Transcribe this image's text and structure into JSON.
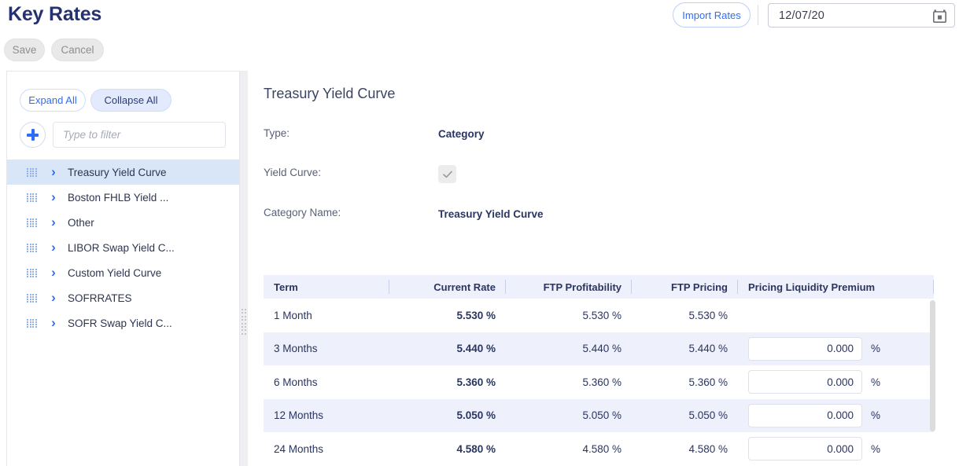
{
  "header": {
    "title": "Key Rates",
    "save_label": "Save",
    "cancel_label": "Cancel",
    "import_label": "Import Rates",
    "date_value": "12/07/20",
    "calendar_icon": "calendar-icon"
  },
  "sidebar": {
    "expand_all_label": "Expand All",
    "collapse_all_label": "Collapse All",
    "add_icon": "plus-icon",
    "filter_placeholder": "Type to filter",
    "filter_value": "",
    "items": [
      {
        "label": "Treasury Yield Curve",
        "selected": true
      },
      {
        "label": "Boston FHLB Yield ...",
        "selected": false
      },
      {
        "label": "Other",
        "selected": false
      },
      {
        "label": "LIBOR Swap Yield C...",
        "selected": false
      },
      {
        "label": "Custom Yield Curve",
        "selected": false
      },
      {
        "label": "SOFRRATES",
        "selected": false
      },
      {
        "label": "SOFR Swap Yield C...",
        "selected": false
      }
    ]
  },
  "detail": {
    "title": "Treasury Yield Curve",
    "type_label": "Type:",
    "type_value": "Category",
    "yield_curve_label": "Yield Curve:",
    "yield_curve_checked": true,
    "category_name_label": "Category Name:",
    "category_name_value": "Treasury Yield Curve"
  },
  "table": {
    "columns": [
      "Term",
      "Current Rate",
      "FTP Profitability",
      "FTP Pricing",
      "Pricing Liquidity Premium"
    ],
    "percent_suffix": "%",
    "rows": [
      {
        "term": "1 Month",
        "current_rate": "5.530 %",
        "ftp_profitability": "5.530 %",
        "ftp_pricing": "5.530 %",
        "pricing_liquidity_premium": null
      },
      {
        "term": "3 Months",
        "current_rate": "5.440 %",
        "ftp_profitability": "5.440 %",
        "ftp_pricing": "5.440 %",
        "pricing_liquidity_premium": "0.000"
      },
      {
        "term": "6 Months",
        "current_rate": "5.360 %",
        "ftp_profitability": "5.360 %",
        "ftp_pricing": "5.360 %",
        "pricing_liquidity_premium": "0.000"
      },
      {
        "term": "12 Months",
        "current_rate": "5.050 %",
        "ftp_profitability": "5.050 %",
        "ftp_pricing": "5.050 %",
        "pricing_liquidity_premium": "0.000"
      },
      {
        "term": "24 Months",
        "current_rate": "4.580 %",
        "ftp_profitability": "4.580 %",
        "ftp_pricing": "4.580 %",
        "pricing_liquidity_premium": "0.000"
      }
    ]
  },
  "colors": {
    "title_navy": "#253170",
    "accent_blue": "#2f6df6",
    "row_alt": "#eef0fb",
    "selected_row": "#d9e6f7"
  }
}
